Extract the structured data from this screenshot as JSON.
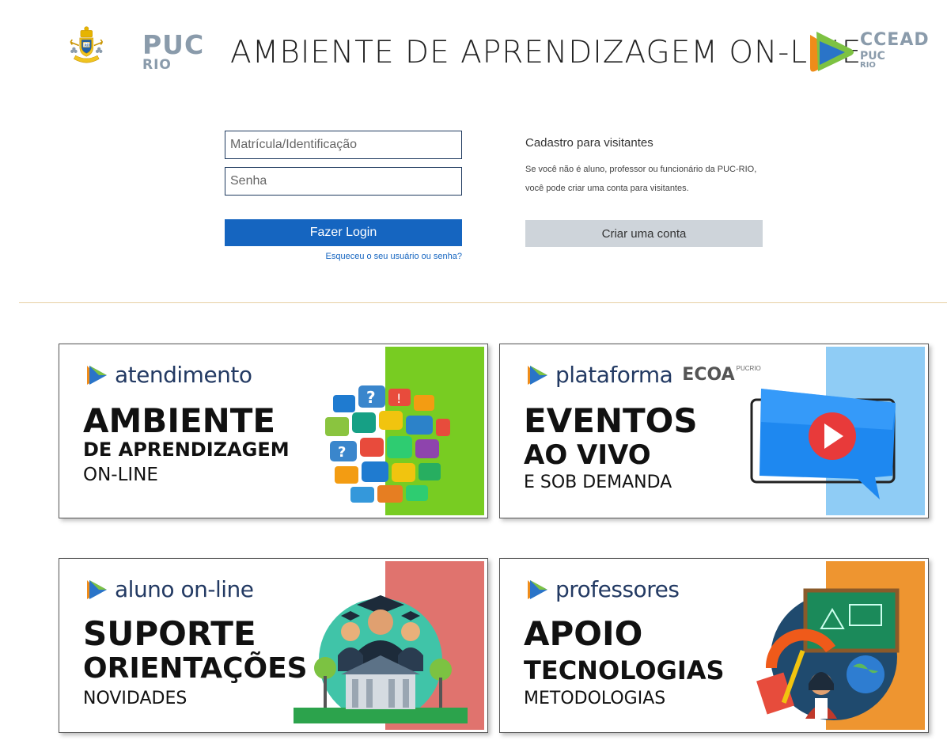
{
  "header": {
    "puc_name": "PUC",
    "puc_sub": "RIO",
    "title": "AMBIENTE DE APRENDIZAGEM ON-LINE",
    "ccead_name": "CCEAD",
    "ccead_puc": "PUC",
    "ccead_rio": "RIO"
  },
  "login": {
    "username_placeholder": "Matrícula/Identificação",
    "password_placeholder": "Senha",
    "login_label": "Fazer Login",
    "forgot_label": "Esqueceu o seu usuário ou senha?"
  },
  "visitors": {
    "title": "Cadastro para visitantes",
    "text": "Se você não é aluno, professor ou funcionário da PUC-RIO, você pode criar uma conta para visitantes.",
    "create_label": "Criar uma conta"
  },
  "cards": [
    {
      "tag": "atendimento",
      "line1": "AMBIENTE",
      "line2": "DE APRENDIZAGEM",
      "line3": "ON-LINE",
      "band_color": "#78cc22"
    },
    {
      "tag": "plataforma",
      "tag_brand": "ECOA",
      "tag_brand_sup": "PUCRIO",
      "line1": "EVENTOS",
      "line2": "AO VIVO",
      "line3": "E SOB DEMANDA",
      "band_color": "#8fccf5"
    },
    {
      "tag": "aluno on-line",
      "line1": "SUPORTE",
      "line2": "ORIENTAÇÕES",
      "line3": "NOVIDADES",
      "band_color": "#e0736e"
    },
    {
      "tag": "professores",
      "line1": "APOIO",
      "line2": "TECNOLOGIAS",
      "line3": "METODOLOGIAS",
      "band_color": "#ee9530"
    }
  ],
  "icons": {
    "puc": "puc-crest-icon",
    "ccead": "ccead-play-icon",
    "tag": "play-triangle-icon"
  }
}
